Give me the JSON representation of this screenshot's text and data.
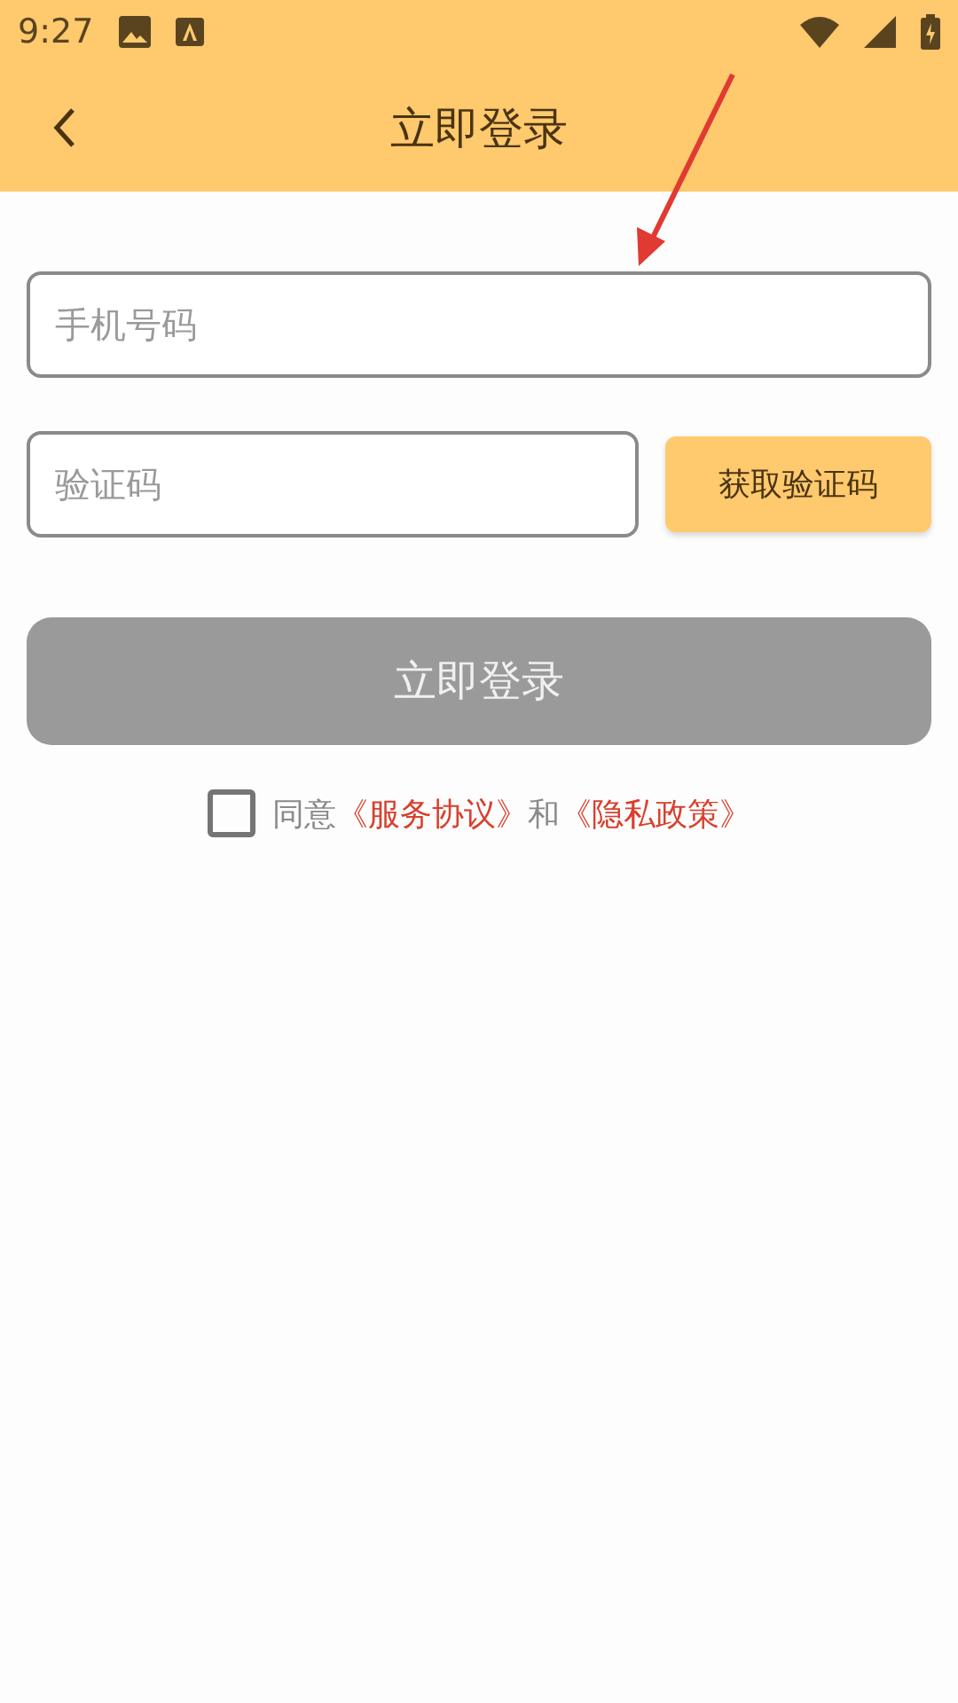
{
  "status_bar": {
    "time": "9:27"
  },
  "header": {
    "title": "立即登录"
  },
  "phone_field": {
    "placeholder": "手机号码"
  },
  "code_field": {
    "placeholder": "验证码"
  },
  "get_code_button": {
    "label": "获取验证码"
  },
  "login_button": {
    "label": "立即登录",
    "disabled": true
  },
  "agreement": {
    "checked": false,
    "parts": [
      {
        "kind": "text",
        "text": "同意"
      },
      {
        "kind": "link",
        "text": "《服务协议》"
      },
      {
        "kind": "text",
        "text": "和"
      },
      {
        "kind": "link",
        "text": "《隐私政策》"
      }
    ]
  },
  "annotation": {
    "kind": "arrow"
  }
}
